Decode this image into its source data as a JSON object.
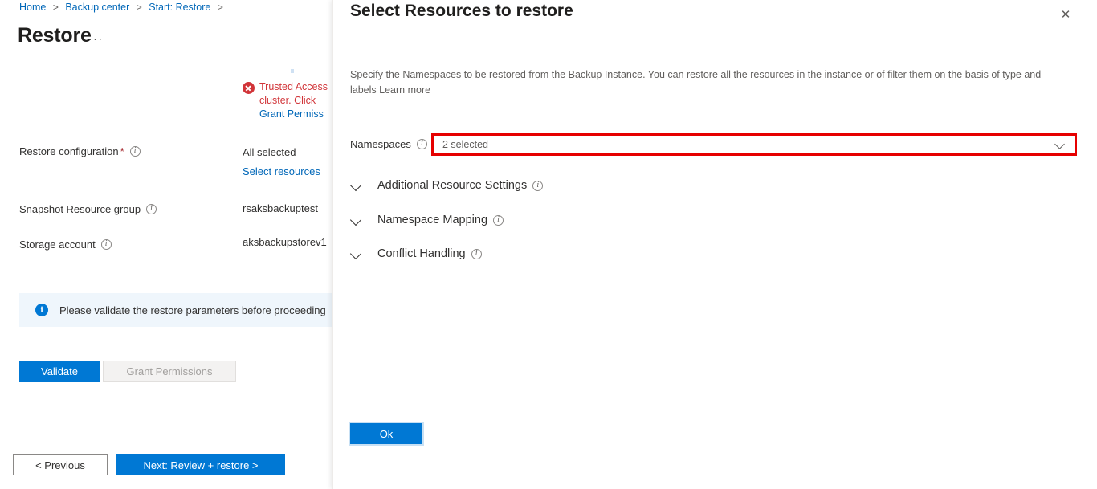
{
  "breadcrumb": {
    "items": [
      "Home",
      "Backup center",
      "Start: Restore"
    ],
    "separator": ">",
    "trailing_separator": ">"
  },
  "page": {
    "title": "Restore",
    "ellipsis": "···"
  },
  "error": {
    "icon": "error-circle-icon",
    "text": "Trusted Access\ncluster. Click",
    "link": "Grant Permiss"
  },
  "fields": [
    {
      "label": "Restore configuration",
      "required": true,
      "info_icon": "info-icon",
      "value": "All selected",
      "link": "Select resources"
    },
    {
      "label": "Snapshot Resource group",
      "required": false,
      "info_icon": "info-icon",
      "value": "rsaksbackuptest",
      "link": ""
    },
    {
      "label": "Storage account",
      "required": false,
      "info_icon": "info-icon",
      "value": "aksbackupstorev1",
      "link": ""
    }
  ],
  "info_bar": {
    "icon": "info-circle-icon",
    "text": "Please validate the restore parameters before proceeding"
  },
  "buttons": {
    "validate": "Validate",
    "grant_permissions": "Grant Permissions",
    "previous": "< Previous",
    "next": "Next: Review + restore >"
  },
  "panel": {
    "title": "Select Resources to restore",
    "close_icon": "close-icon",
    "description": "Specify the Namespaces to be restored from the Backup Instance. You can restore all the resources in the instance or of filter them on the basis of type and labels Learn more",
    "namespaces": {
      "label": "Namespaces",
      "info_icon": "info-icon",
      "value": "2 selected",
      "chevron_icon": "chevron-down-icon",
      "highlight_color": "#e60000"
    },
    "sections": [
      {
        "label": "Additional Resource Settings",
        "chevron_icon": "chevron-down-icon",
        "info_icon": "info-icon"
      },
      {
        "label": "Namespace Mapping",
        "chevron_icon": "chevron-down-icon",
        "info_icon": "info-icon"
      },
      {
        "label": "Conflict Handling",
        "chevron_icon": "chevron-down-icon",
        "info_icon": "info-icon"
      }
    ],
    "ok_button": "Ok"
  },
  "colors": {
    "accent": "#0078d4",
    "link": "#0067b8",
    "error": "#d13438",
    "highlight": "#e60000",
    "info_bg": "#eff6fc"
  }
}
